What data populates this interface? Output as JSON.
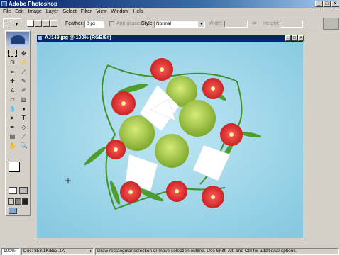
{
  "app": {
    "title": "Adobe Photoshop"
  },
  "window_buttons": {
    "minimize": "_",
    "maximize": "□",
    "close": "×"
  },
  "menu": [
    "File",
    "Edit",
    "Image",
    "Layer",
    "Select",
    "Filter",
    "View",
    "Window",
    "Help"
  ],
  "options": {
    "feather_label": "Feather:",
    "feather_value": "0 px",
    "antialiased_label": "Anti-aliased",
    "style_label": "Style:",
    "style_value": "Normal",
    "width_label": "Width:",
    "width_value": "",
    "height_label": "Height:",
    "height_value": ""
  },
  "document": {
    "title": "AJ149.jpg @ 100% (RGB/8#)"
  },
  "status": {
    "zoom": "100%",
    "doc_size": "Doc: 853.1K/853.1K",
    "hint": "Draw rectangular selection or move selection outline.  Use Shift, Alt, and Ctrl for additional options."
  },
  "colors": {
    "canvas_bg": "#9cd6ea",
    "title_bar": "#0a246a",
    "alstroemeria": "#d8232a",
    "lily": "#ffffff",
    "hydrangea": "#9fc43c"
  }
}
